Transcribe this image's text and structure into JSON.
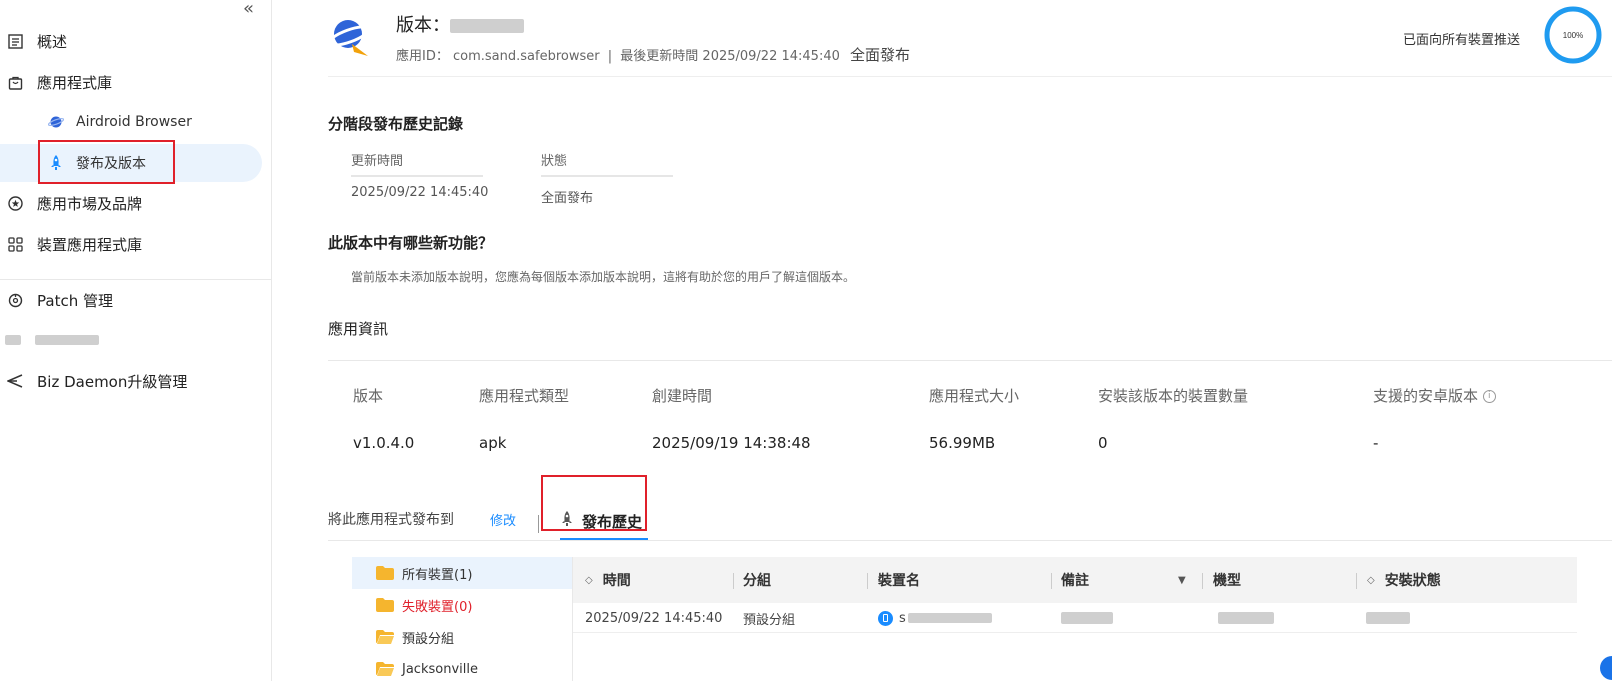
{
  "sidebar": {
    "items": [
      {
        "label": "概述",
        "icon": "list-icon"
      },
      {
        "label": "應用程式庫",
        "icon": "bag-icon"
      },
      {
        "label": "Airdroid Browser",
        "icon": "app-planet-icon"
      },
      {
        "label": "發布及版本",
        "icon": "rocket-icon"
      },
      {
        "label": "應用市場及品牌",
        "icon": "star-circle-icon"
      },
      {
        "label": "裝置應用程式庫",
        "icon": "grid-icon"
      },
      {
        "label": "Patch 管理",
        "icon": "patch-icon"
      },
      {
        "label": "Biz Daemon升級管理",
        "icon": "send-icon"
      }
    ]
  },
  "header": {
    "version_prefix": "版本：",
    "app_id_label": "應用ID：",
    "app_id": "com.sand.safebrowser",
    "separator": "|",
    "last_update_label": "最後更新時間",
    "last_update": "2025/09/22 14:45:40",
    "release_status": "全面發布",
    "push_text": "已面向所有裝置推送",
    "progress_label": "100%",
    "progress_value": 1.0
  },
  "staged_history": {
    "title": "分階段發布歷史記錄",
    "columns": [
      "更新時間",
      "狀態"
    ],
    "rows": [
      [
        "2025/09/22 14:45:40",
        "全面發布"
      ]
    ]
  },
  "whats_new": {
    "title": "此版本中有哪些新功能？",
    "note": "當前版本未添加版本說明，您應為每個版本添加版本說明，這將有助於您的用戶了解這個版本。"
  },
  "app_info": {
    "title": "應用資訊",
    "headers": [
      "版本",
      "應用程式類型",
      "創建時間",
      "應用程式大小",
      "安裝該版本的裝置數量",
      "支援的安卓版本"
    ],
    "values": [
      "v1.0.4.0",
      "apk",
      "2025/09/19 14:38:48",
      "56.99MB",
      "0",
      "-"
    ]
  },
  "distribution": {
    "label": "將此應用程式發布到",
    "edit_label": "修改",
    "tab_label": "發布歷史"
  },
  "tree": {
    "items": [
      "所有裝置(1)",
      "失敗裝置(0)",
      "預設分組",
      "Jacksonville"
    ]
  },
  "table": {
    "headers": [
      "時間",
      "分組",
      "裝置名",
      "備註",
      "機型",
      "安裝狀態"
    ],
    "rows": [
      {
        "time": "2025/09/22 14:45:40",
        "group": "預設分組",
        "device_prefix": "s"
      }
    ]
  },
  "colors": {
    "accent": "#1a8cff",
    "highlight_border": "#e0202a",
    "ring": "#1f9bf0"
  }
}
